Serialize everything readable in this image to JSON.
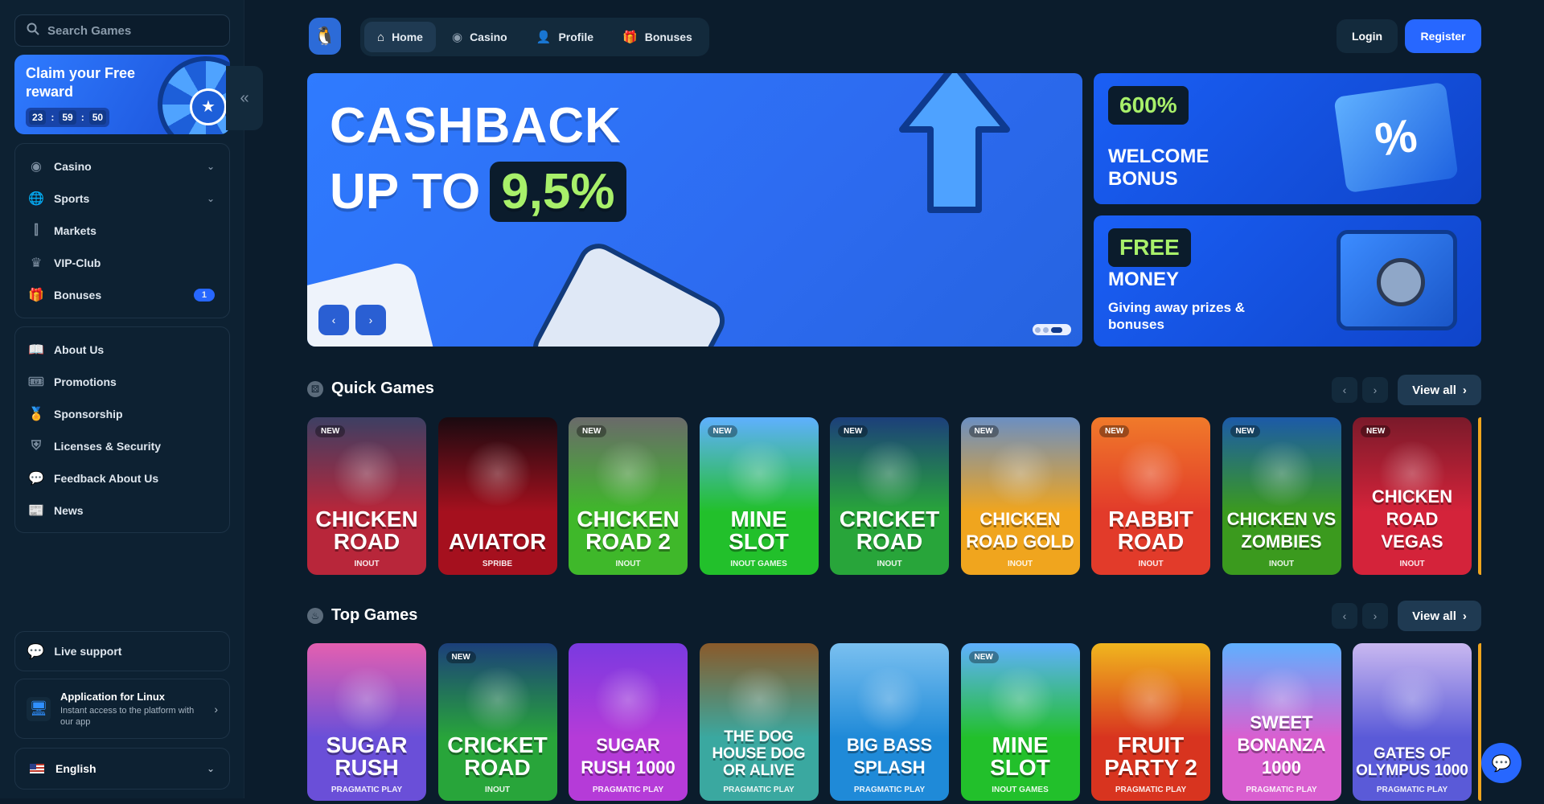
{
  "sidebar": {
    "search_placeholder": "Search Games",
    "reward": {
      "title": "Claim your Free reward",
      "hours": "23",
      "minutes": "59",
      "seconds": "50"
    },
    "nav_main": [
      {
        "label": "Casino",
        "icon": "casino-chip-icon",
        "expandable": true
      },
      {
        "label": "Sports",
        "icon": "globe-icon",
        "expandable": true
      },
      {
        "label": "Markets",
        "icon": "candlestick-icon"
      },
      {
        "label": "VIP-Club",
        "icon": "crown-icon"
      },
      {
        "label": "Bonuses",
        "icon": "gift-icon",
        "badge": "1"
      }
    ],
    "nav_info": [
      {
        "label": "About Us",
        "icon": "book-icon"
      },
      {
        "label": "Promotions",
        "icon": "ticket-icon"
      },
      {
        "label": "Sponsorship",
        "icon": "medal-icon"
      },
      {
        "label": "Licenses & Security",
        "icon": "shield-icon"
      },
      {
        "label": "Feedback About Us",
        "icon": "chat-bubble-icon"
      },
      {
        "label": "News",
        "icon": "newspaper-icon"
      }
    ],
    "support_label": "Live support",
    "app": {
      "title": "Application for Linux",
      "subtitle": "Instant access to the platform with our app"
    },
    "language": "English"
  },
  "header": {
    "tabs": [
      {
        "label": "Home",
        "icon": "home-icon",
        "active": true
      },
      {
        "label": "Casino",
        "icon": "casino-chip-icon"
      },
      {
        "label": "Profile",
        "icon": "user-icon"
      },
      {
        "label": "Bonuses",
        "icon": "gift-icon"
      }
    ],
    "login": "Login",
    "register": "Register"
  },
  "hero": {
    "line1": "CASHBACK",
    "line2": "UP TO",
    "percent": "9,5%",
    "slides": 3,
    "active_slide": 3
  },
  "promos": [
    {
      "tag": "600%",
      "title": "WELCOME BONUS"
    },
    {
      "tag": "FREE",
      "title": "MONEY",
      "subtitle": "Giving away prizes & bonuses"
    }
  ],
  "sections": {
    "quick": {
      "title": "Quick Games",
      "view_all": "View all"
    },
    "top": {
      "title": "Top Games",
      "view_all": "View all"
    }
  },
  "quick_games": [
    {
      "name": "CHICKEN ROAD",
      "provider": "INOUT",
      "new": true,
      "bg": "#b8263a",
      "bg2": "#3d3f63"
    },
    {
      "name": "AVIATOR",
      "provider": "SPRIBE",
      "new": false,
      "bg": "#a5101e",
      "bg2": "#1a0a10"
    },
    {
      "name": "CHICKEN ROAD 2",
      "provider": "INOUT",
      "new": true,
      "bg": "#3fb82a",
      "bg2": "#6a6a6a"
    },
    {
      "name": "MINE SLOT",
      "provider": "INOUT GAMES",
      "new": true,
      "bg": "#22c02b",
      "bg2": "#5fb0ff"
    },
    {
      "name": "CRICKET ROAD",
      "provider": "INOUT",
      "new": true,
      "bg": "#28a53a",
      "bg2": "#1c3f7a"
    },
    {
      "name": "CHICKEN ROAD GOLD",
      "provider": "INOUT",
      "new": true,
      "bg": "#f0a51e",
      "bg2": "#6b8fc2"
    },
    {
      "name": "RABBIT ROAD",
      "provider": "INOUT",
      "new": true,
      "bg": "#e23b2a",
      "bg2": "#f07a2a"
    },
    {
      "name": "CHICKEN VS ZOMBIES",
      "provider": "INOUT",
      "new": true,
      "bg": "#3b9a1e",
      "bg2": "#1c5aa8"
    },
    {
      "name": "CHICKEN ROAD VEGAS",
      "provider": "INOUT",
      "new": true,
      "bg": "#d4233a",
      "bg2": "#7a1a2a"
    }
  ],
  "top_games": [
    {
      "name": "SUGAR RUSH",
      "provider": "PRAGMATIC PLAY",
      "new": false,
      "bg": "#6a4fd8",
      "bg2": "#e45fb0"
    },
    {
      "name": "CRICKET ROAD",
      "provider": "INOUT",
      "new": true,
      "bg": "#28a53a",
      "bg2": "#1c3f7a"
    },
    {
      "name": "SUGAR RUSH 1000",
      "provider": "PRAGMATIC PLAY",
      "new": false,
      "bg": "#b53bd8",
      "bg2": "#7a3ae0"
    },
    {
      "name": "THE DOG HOUSE DOG OR ALIVE",
      "provider": "PRAGMATIC PLAY",
      "new": false,
      "bg": "#3aa8a0",
      "bg2": "#8a5a2a"
    },
    {
      "name": "BIG BASS SPLASH",
      "provider": "PRAGMATIC PLAY",
      "new": false,
      "bg": "#1f8ad8",
      "bg2": "#7ac0f0"
    },
    {
      "name": "MINE SLOT",
      "provider": "INOUT GAMES",
      "new": true,
      "bg": "#22c02b",
      "bg2": "#5fb0ff"
    },
    {
      "name": "FRUIT PARTY 2",
      "provider": "PRAGMATIC PLAY",
      "new": false,
      "bg": "#d8341f",
      "bg2": "#f0b61e"
    },
    {
      "name": "SWEET BONANZA 1000",
      "provider": "PRAGMATIC PLAY",
      "new": false,
      "bg": "#d95fd0",
      "bg2": "#5fb0ff"
    },
    {
      "name": "GATES OF OLYMPUS 1000",
      "provider": "PRAGMATIC PLAY",
      "new": false,
      "bg": "#5a5ad8",
      "bg2": "#c9b8f0"
    }
  ],
  "colors": {
    "bg": "#0b1c2c",
    "sidebar": "#0d2132",
    "accent": "#2767ff",
    "green": "#a8f06a"
  }
}
